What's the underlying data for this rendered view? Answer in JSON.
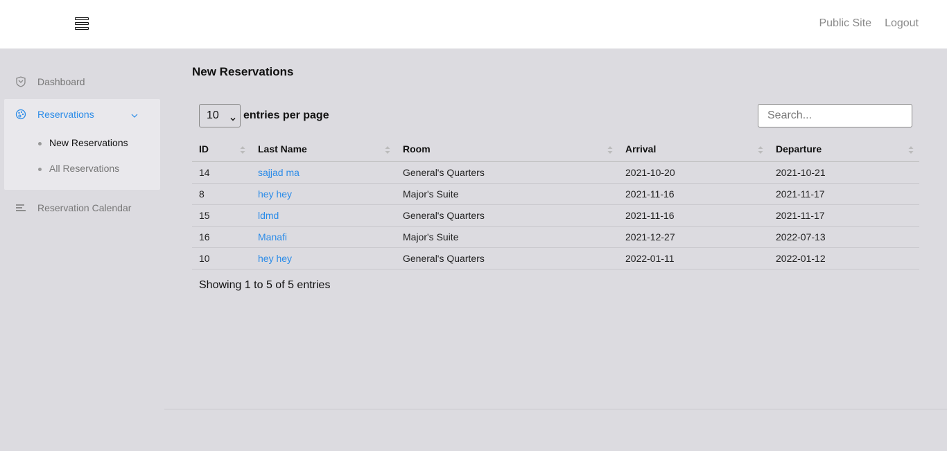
{
  "header": {
    "menu_icon": "hamburger-icon",
    "links": {
      "public_site": "Public Site",
      "logout": "Logout"
    }
  },
  "sidebar": {
    "dashboard": {
      "label": "Dashboard",
      "icon": "dashboard-icon"
    },
    "reservations": {
      "label": "Reservations",
      "icon": "palette-icon",
      "expanded": true,
      "children": [
        {
          "label": "New Reservations",
          "active": true
        },
        {
          "label": "All Reservations",
          "active": false
        }
      ]
    },
    "calendar": {
      "label": "Reservation Calendar",
      "icon": "list-icon"
    }
  },
  "main": {
    "title": "New Reservations",
    "per_page": {
      "selected": "10",
      "label": "entries per page"
    },
    "search": {
      "placeholder": "Search..."
    },
    "table": {
      "columns": [
        "ID",
        "Last Name",
        "Room",
        "Arrival",
        "Departure"
      ],
      "rows": [
        {
          "id": "14",
          "last_name": "sajjad ma",
          "room": "General's Quarters",
          "arrival": "2021-10-20",
          "departure": "2021-10-21"
        },
        {
          "id": "8",
          "last_name": "hey hey",
          "room": "Major's Suite",
          "arrival": "2021-11-16",
          "departure": "2021-11-17"
        },
        {
          "id": "15",
          "last_name": "ldmd",
          "room": "General's Quarters",
          "arrival": "2021-11-16",
          "departure": "2021-11-17"
        },
        {
          "id": "16",
          "last_name": "Manafi",
          "room": "Major's Suite",
          "arrival": "2021-12-27",
          "departure": "2022-07-13"
        },
        {
          "id": "10",
          "last_name": "hey hey",
          "room": "General's Quarters",
          "arrival": "2022-01-11",
          "departure": "2022-01-12"
        }
      ]
    },
    "info": "Showing 1 to 5 of 5 entries"
  },
  "colors": {
    "accent": "#2a8be8",
    "background": "#dcdbe0",
    "topbar": "#ffffff",
    "submenu": "#e9e8ec"
  }
}
